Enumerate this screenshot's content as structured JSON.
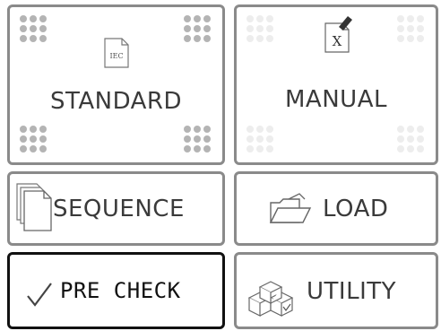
{
  "menu": {
    "standard": {
      "label": "STANDARD",
      "icon_text": "IEC",
      "icon": "iec-document-icon"
    },
    "manual": {
      "label": "MANUAL",
      "icon_text": "X",
      "icon": "edit-document-icon"
    },
    "sequence": {
      "label": "SEQUENCE",
      "icon": "stacked-pages-icon"
    },
    "load": {
      "label": "LOAD",
      "icon": "open-folder-icon"
    },
    "pre_check": {
      "label": "PRE CHECK",
      "icon": "checkmark-icon",
      "selected": true
    },
    "utility": {
      "label": "UTILITY",
      "icon": "boxes-icon"
    }
  },
  "colors": {
    "border": "#8a8a8a",
    "selected_border": "#111111",
    "text": "#3a3a3a",
    "dots_dark": "#b4b4b4",
    "dots_light": "#ededed"
  }
}
